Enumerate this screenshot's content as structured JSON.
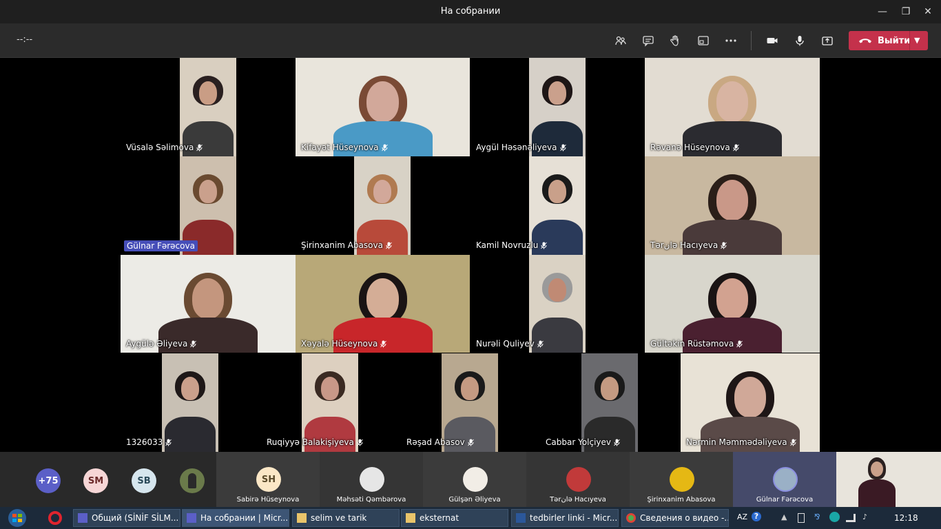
{
  "window": {
    "title": "На собрании",
    "minimize": "—",
    "restore": "❐",
    "close": "✕"
  },
  "toolbar": {
    "timer": "--:--",
    "leave_label": "Выйти",
    "icons": [
      "participants-icon",
      "chat-icon",
      "raise-hand-icon",
      "share-tray-icon",
      "more-icon",
      "camera-icon",
      "mic-icon",
      "share-icon"
    ],
    "leave_color": "#c4314b"
  },
  "participants": [
    {
      "name": "Vüsalə Səlimova"
    },
    {
      "name": "Kifayət Hüseynova"
    },
    {
      "name": "Aygül Həsənəliyeva"
    },
    {
      "name": "Rəvanə Hüseynova"
    },
    {
      "name": "Gülnar Fərəcova"
    },
    {
      "name": "Şirinxanim Abasova"
    },
    {
      "name": "Kamil Novruzlu"
    },
    {
      "name": "Tərانə Hacıyeva"
    },
    {
      "name": "Aygülə Əliyeva"
    },
    {
      "name": "Xəyalə Hüseynova"
    },
    {
      "name": "Nurəli Quliyev"
    },
    {
      "name": "Gültəkin Rüstəmova"
    },
    {
      "name": "1326033"
    },
    {
      "name": "Ruqiyyə Balakişiyeva"
    },
    {
      "name": "Rəşad Abasov"
    },
    {
      "name": "Cabbar Yolçiyev"
    },
    {
      "name": "Nərmin Məmmədəliyeva"
    }
  ],
  "strip": {
    "overflow": "+75",
    "avatars": [
      "SM",
      "SB"
    ],
    "tiles": [
      {
        "initials": "SH",
        "name": "Sabirə Hüseynova"
      },
      {
        "initials": "",
        "name": "Məhsəti Qəmbərova"
      },
      {
        "initials": "",
        "name": "Gülşən Əliyeva"
      },
      {
        "initials": "",
        "name": "Tərانə Hacıyeva"
      },
      {
        "initials": "",
        "name": "Şirinxanim Abasova"
      },
      {
        "initials": "",
        "name": "Gülnar Fərəcova"
      }
    ]
  },
  "taskbar": {
    "items": [
      {
        "label": "Общий (SİNİF SİLM..."
      },
      {
        "label": "На собрании | Micr..."
      },
      {
        "label": "selim ve tarik"
      },
      {
        "label": "eksternat"
      },
      {
        "label": "tedbirler linki - Micr..."
      },
      {
        "label": "Сведения о видео -..."
      }
    ],
    "lang": "AZ",
    "clock": "12:18"
  }
}
